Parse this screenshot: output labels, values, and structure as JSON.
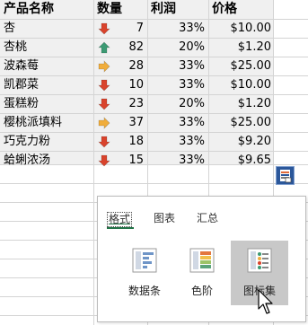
{
  "table": {
    "headers": [
      "产品名称",
      "数量",
      "利润",
      "价格"
    ],
    "rows": [
      {
        "name": "杏",
        "qty": "7",
        "arrow": "down",
        "profit": "33%",
        "price": "$10.00"
      },
      {
        "name": "杏桃",
        "qty": "82",
        "arrow": "up",
        "profit": "20%",
        "price": "$1.20"
      },
      {
        "name": "波森莓",
        "qty": "28",
        "arrow": "right",
        "profit": "33%",
        "price": "$25.00"
      },
      {
        "name": "凯郡菜",
        "qty": "10",
        "arrow": "down",
        "profit": "33%",
        "price": "$10.00"
      },
      {
        "name": "蛋糕粉",
        "qty": "23",
        "arrow": "down",
        "profit": "20%",
        "price": "$1.20"
      },
      {
        "name": "樱桃派填料",
        "qty": "37",
        "arrow": "right",
        "profit": "33%",
        "price": "$25.00"
      },
      {
        "name": "巧克力粉",
        "qty": "18",
        "arrow": "down",
        "profit": "33%",
        "price": "$9.20"
      },
      {
        "name": "蛤蜊浓汤",
        "qty": "15",
        "arrow": "down",
        "profit": "33%",
        "price": "$9.65"
      }
    ]
  },
  "quick_analysis": {
    "tabs": [
      "格式",
      "图表",
      "汇总"
    ],
    "active_tab": "格式",
    "options": [
      "数据条",
      "色阶",
      "图标集"
    ],
    "hovered_option": "图标集"
  },
  "colors": {
    "arrow_down": "#d9432c",
    "arrow_up": "#3c9a73",
    "arrow_right": "#f0ad3c",
    "accent": "#217346"
  }
}
